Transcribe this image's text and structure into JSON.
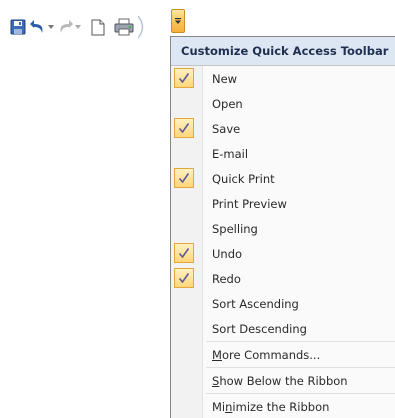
{
  "qat": {
    "buttons": [
      {
        "name": "save-icon"
      },
      {
        "name": "undo-icon"
      },
      {
        "name": "redo-icon"
      },
      {
        "name": "new-document-icon"
      },
      {
        "name": "quick-print-icon"
      }
    ],
    "dropdown_icon": "chevron-down-icon"
  },
  "menu": {
    "title": "Customize Quick Access Toolbar",
    "items": [
      {
        "label": "New",
        "checked": true
      },
      {
        "label": "Open",
        "checked": false
      },
      {
        "label": "Save",
        "checked": true
      },
      {
        "label": "E-mail",
        "checked": false
      },
      {
        "label": "Quick Print",
        "checked": true
      },
      {
        "label": "Print Preview",
        "checked": false
      },
      {
        "label": "Spelling",
        "checked": false
      },
      {
        "label": "Undo",
        "checked": true
      },
      {
        "label": "Redo",
        "checked": true
      },
      {
        "label": "Sort Ascending",
        "checked": false
      },
      {
        "label": "Sort Descending",
        "checked": false
      }
    ],
    "more_commands": {
      "pre": "",
      "key": "M",
      "post": "ore Commands..."
    },
    "show_below": {
      "pre": "",
      "key": "S",
      "post": "how Below the Ribbon"
    },
    "minimize": {
      "pre": "Mi",
      "key": "n",
      "post": "imize the Ribbon"
    }
  },
  "colors": {
    "accent": "#f8c35a",
    "check": "#5a5a9a",
    "header_bg": "#dde7f3"
  }
}
